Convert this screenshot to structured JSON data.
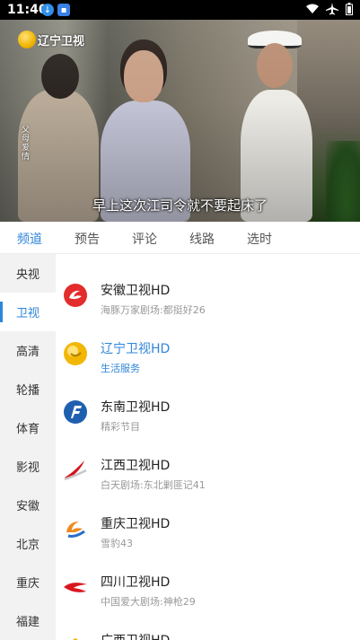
{
  "status_bar": {
    "time": "11:40",
    "icons": [
      "download-icon",
      "gallery-icon",
      "wifi-icon",
      "airplane-icon",
      "battery-icon"
    ]
  },
  "video": {
    "channel_logo_text": "辽宁卫视",
    "side_caption": "父母爱情",
    "subtitle": "早上这次江司令就不要起床了"
  },
  "tabs": [
    {
      "label": "频道",
      "active": true
    },
    {
      "label": "预告",
      "active": false
    },
    {
      "label": "评论",
      "active": false
    },
    {
      "label": "线路",
      "active": false
    },
    {
      "label": "选时",
      "active": false
    }
  ],
  "categories": [
    {
      "label": "央视",
      "active": false
    },
    {
      "label": "卫视",
      "active": true
    },
    {
      "label": "高清",
      "active": false
    },
    {
      "label": "轮播",
      "active": false
    },
    {
      "label": "体育",
      "active": false
    },
    {
      "label": "影视",
      "active": false
    },
    {
      "label": "安徽",
      "active": false
    },
    {
      "label": "北京",
      "active": false
    },
    {
      "label": "重庆",
      "active": false
    },
    {
      "label": "福建",
      "active": false
    }
  ],
  "channels": [
    {
      "name": "安徽卫视HD",
      "program": "海豚万家剧场:都挺好26",
      "logo": "anhui-tv-logo",
      "active": false
    },
    {
      "name": "辽宁卫视HD",
      "program": "生活服务",
      "logo": "liaoning-tv-logo",
      "active": true
    },
    {
      "name": "东南卫视HD",
      "program": "精彩节目",
      "logo": "dongnan-tv-logo",
      "active": false
    },
    {
      "name": "江西卫视HD",
      "program": "白天剧场:东北剿匪记41",
      "logo": "jiangxi-tv-logo",
      "active": false
    },
    {
      "name": "重庆卫视HD",
      "program": "雪豹43",
      "logo": "chongqing-tv-logo",
      "active": false
    },
    {
      "name": "四川卫视HD",
      "program": "中国爱大剧场:神枪29",
      "logo": "sichuan-tv-logo",
      "active": false
    },
    {
      "name": "广西卫视HD",
      "program": "",
      "logo": "guangxi-tv-logo",
      "active": false
    }
  ],
  "colors": {
    "accent": "#2f86d8",
    "sidebar_bg": "#f2f2f2",
    "secondary_text": "#999999"
  }
}
